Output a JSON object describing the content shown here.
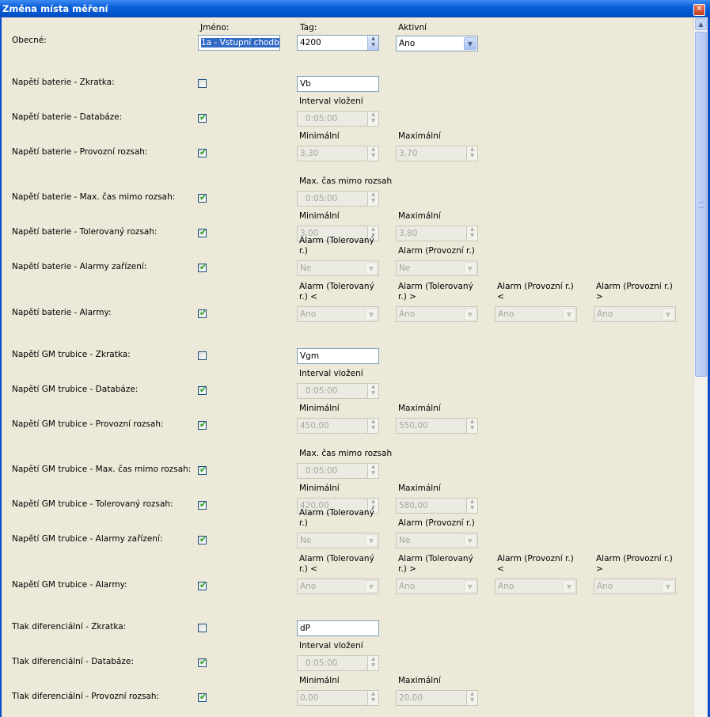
{
  "window": {
    "title": "Změna místa měření"
  },
  "header": {
    "row_label": "Obecné:",
    "name_caption": "Jméno:",
    "name_value": "1a - Vstupní chodba",
    "tag_caption": "Tag:",
    "tag_value": "4200",
    "active_caption": "Aktivní",
    "active_value": "Ano"
  },
  "sections": [
    {
      "rows": [
        {
          "label": "Napětí baterie - Zkratka:",
          "checked": false,
          "kind": "text",
          "caps": [],
          "values": [
            "Vb"
          ]
        },
        {
          "label": "Napětí baterie - Databáze:",
          "checked": true,
          "kind": "spin",
          "caps": [
            "Interval vložení"
          ],
          "values": [
            "0:05:00"
          ]
        },
        {
          "label": "Napětí baterie - Provozní rozsah:",
          "checked": true,
          "kind": "spin",
          "caps": [
            "Minimální",
            "Maximální"
          ],
          "values": [
            "3,30",
            "3,70"
          ]
        },
        {
          "label": "Napětí baterie - Max. čas mimo rozsah:",
          "checked": true,
          "kind": "spin",
          "caps": [
            "Max. čas mimo rozsah"
          ],
          "values": [
            "0:05:00"
          ]
        },
        {
          "label": "Napětí baterie - Tolerovaný rozsah:",
          "checked": true,
          "kind": "spin",
          "caps": [
            "Minimální",
            "Maximální"
          ],
          "values": [
            "3,00",
            "3,80"
          ]
        },
        {
          "label": "Napětí baterie - Alarmy zařízení:",
          "checked": true,
          "kind": "dd",
          "caps": [
            "Alarm (Tolerovaný r.)",
            "Alarm (Provozní r.)"
          ],
          "values": [
            "Ne",
            "Ne"
          ]
        },
        {
          "label": "Napětí baterie - Alarmy:",
          "checked": true,
          "kind": "dd",
          "caps": [
            "Alarm (Tolerovaný r.) <",
            "Alarm (Tolerovaný r.) >",
            "Alarm (Provozní r.) <",
            "Alarm (Provozní r.) >"
          ],
          "values": [
            "Ano",
            "Ano",
            "Ano",
            "Ano"
          ]
        }
      ]
    },
    {
      "rows": [
        {
          "label": "Napětí GM trubice - Zkratka:",
          "checked": false,
          "kind": "text",
          "caps": [],
          "values": [
            "Vgm"
          ]
        },
        {
          "label": "Napětí GM trubice - Databáze:",
          "checked": true,
          "kind": "spin",
          "caps": [
            "Interval vložení"
          ],
          "values": [
            "0:05:00"
          ]
        },
        {
          "label": "Napětí GM trubice - Provozní rozsah:",
          "checked": true,
          "kind": "spin",
          "caps": [
            "Minimální",
            "Maximální"
          ],
          "values": [
            "450,00",
            "550,00"
          ]
        },
        {
          "label": "Napětí GM trubice - Max. čas mimo rozsah:",
          "checked": true,
          "kind": "spin",
          "caps": [
            "Max. čas mimo rozsah"
          ],
          "values": [
            "0:05:00"
          ]
        },
        {
          "label": "Napětí GM trubice - Tolerovaný rozsah:",
          "checked": true,
          "kind": "spin",
          "caps": [
            "Minimální",
            "Maximální"
          ],
          "values": [
            "420,00",
            "580,00"
          ]
        },
        {
          "label": "Napětí GM trubice - Alarmy zařízení:",
          "checked": true,
          "kind": "dd",
          "caps": [
            "Alarm (Tolerovaný r.)",
            "Alarm (Provozní r.)"
          ],
          "values": [
            "Ne",
            "Ne"
          ]
        },
        {
          "label": "Napětí GM trubice - Alarmy:",
          "checked": true,
          "kind": "dd",
          "caps": [
            "Alarm (Tolerovaný r.) <",
            "Alarm (Tolerovaný r.) >",
            "Alarm (Provozní r.) <",
            "Alarm (Provozní r.) >"
          ],
          "values": [
            "Ano",
            "Ano",
            "Ano",
            "Ano"
          ]
        }
      ]
    },
    {
      "rows": [
        {
          "label": "Tlak diferenciální - Zkratka:",
          "checked": false,
          "kind": "text",
          "caps": [],
          "values": [
            "dP"
          ]
        },
        {
          "label": "Tlak diferenciální - Databáze:",
          "checked": true,
          "kind": "spin",
          "caps": [
            "Interval vložení"
          ],
          "values": [
            "0:05:00"
          ]
        },
        {
          "label": "Tlak diferenciální - Provozní rozsah:",
          "checked": true,
          "kind": "spin",
          "caps": [
            "Minimální",
            "Maximální"
          ],
          "values": [
            "0,00",
            "20,00"
          ]
        }
      ]
    }
  ]
}
